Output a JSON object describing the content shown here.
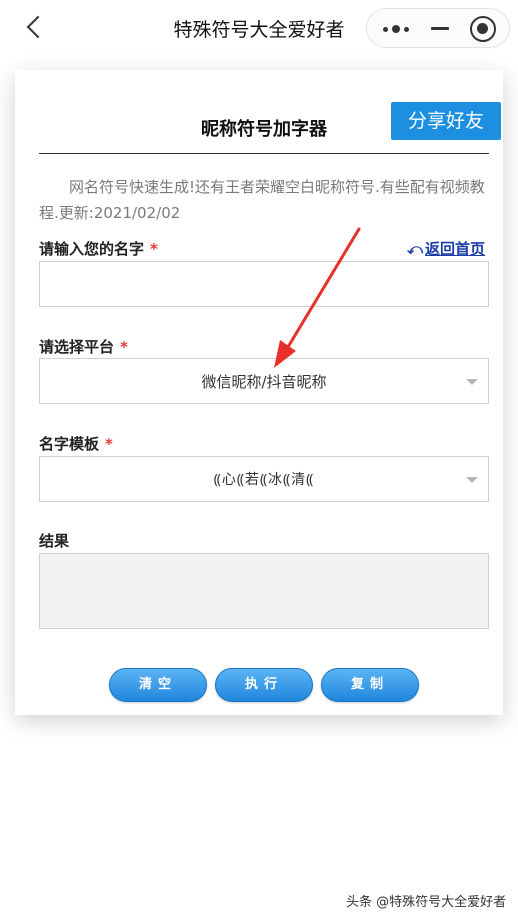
{
  "nav": {
    "title": "特殊符号大全爱好者",
    "back_icon": "chevron-left-icon",
    "more_icon": "more-dots-icon",
    "minimize_icon": "minimize-icon",
    "close_icon": "target-close-icon"
  },
  "card": {
    "title": "昵称符号加字器",
    "share_label": "分享好友",
    "intro": "网名符号快速生成!还有王者荣耀空白昵称符号.有些配有视频教程.更新:2021/02/02",
    "name_label": "请输入您的名字",
    "required_mark": "*",
    "home_link": "返回首页",
    "home_link_icon": "return-arrow-icon",
    "name_value": "",
    "platform_label": "请选择平台",
    "platform_selected": "微信昵称/抖音昵称",
    "template_label": "名字模板",
    "template_selected": "⸨心⸨若⸨冰⸨清⸨",
    "result_label": "结果",
    "result_value": "",
    "buttons": {
      "clear": "清空",
      "run": "执行",
      "copy": "复制"
    }
  },
  "colors": {
    "accent": "#1d8fe0",
    "required": "#e53935",
    "link": "#1a3ca8",
    "annotation_arrow": "#e8302a"
  },
  "watermark": "头条 @特殊符号大全爱好者"
}
